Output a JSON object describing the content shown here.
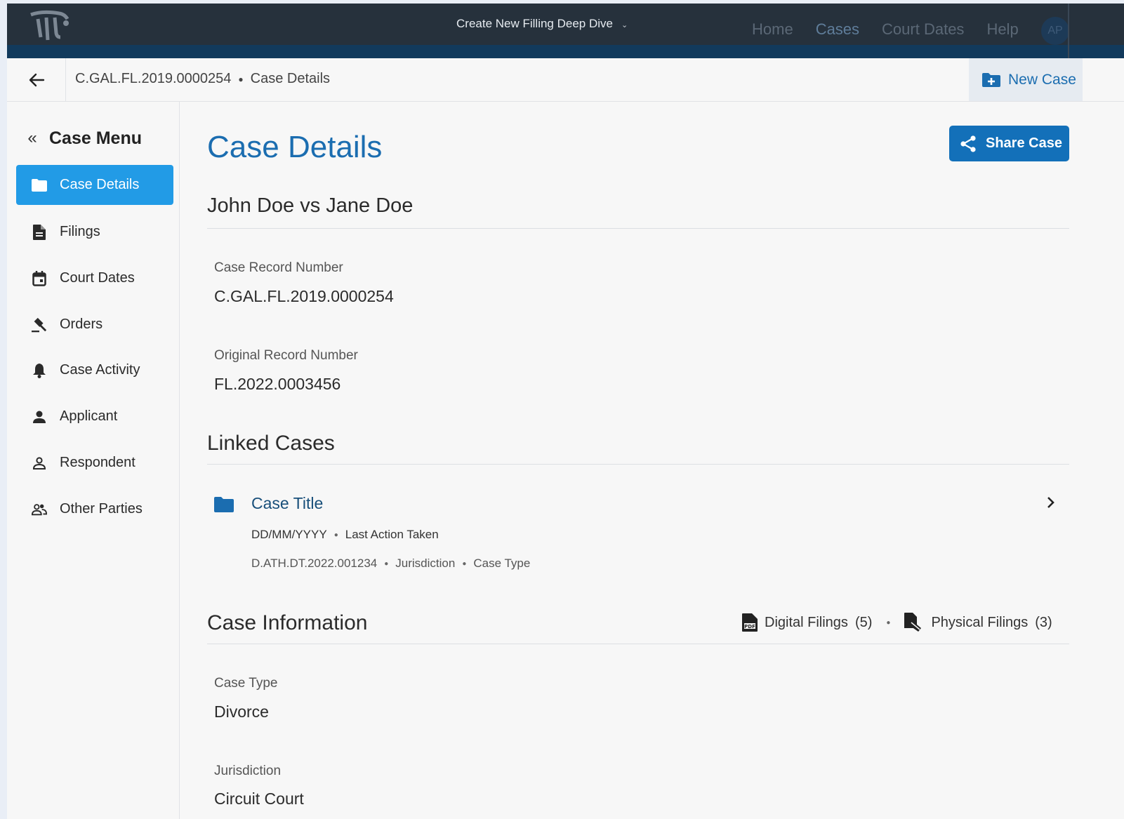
{
  "topbar": {
    "app_title": "Create New Filling Deep Dive",
    "nav": [
      "Home",
      "Cases",
      "Court Dates",
      "Help"
    ],
    "active_nav": "Cases",
    "avatar_initials": "AP"
  },
  "breadcrumb": {
    "case_number": "C.GAL.FL.2019.0000254",
    "page": "Case Details"
  },
  "new_case_label": "New Case",
  "sidebar": {
    "title": "Case Menu",
    "items": [
      {
        "label": "Case Details",
        "icon": "folder-icon",
        "active": true
      },
      {
        "label": "Filings",
        "icon": "document-icon"
      },
      {
        "label": "Court Dates",
        "icon": "calendar-icon"
      },
      {
        "label": "Orders",
        "icon": "gavel-icon"
      },
      {
        "label": "Case Activity",
        "icon": "bell-icon"
      },
      {
        "label": "Applicant",
        "icon": "person-icon"
      },
      {
        "label": "Respondent",
        "icon": "person-outline-icon"
      },
      {
        "label": "Other Parties",
        "icon": "people-icon"
      }
    ]
  },
  "main": {
    "title": "Case Details",
    "share_label": "Share Case",
    "case_name": "John Doe vs Jane Doe",
    "fields_top": [
      {
        "label": "Case Record Number",
        "value": "C.GAL.FL.2019.0000254"
      },
      {
        "label": "Original Record Number",
        "value": "FL.2022.0003456"
      }
    ],
    "linked_cases": {
      "title": "Linked Cases",
      "items": [
        {
          "title": "Case Title",
          "date": "DD/MM/YYYY",
          "last_action": "Last Action Taken",
          "record": "D.ATH.DT.2022.001234",
          "jurisdiction": "Jurisdiction",
          "case_type": "Case Type"
        }
      ]
    },
    "case_information": {
      "title": "Case Information",
      "digital_filings_label": "Digital Filings",
      "digital_filings_count": "(5)",
      "physical_filings_label": "Physical Filings",
      "physical_filings_count": "(3)",
      "fields": [
        {
          "label": "Case Type",
          "value": "Divorce"
        },
        {
          "label": "Jurisdiction",
          "value": "Circuit Court"
        }
      ]
    }
  },
  "colors": {
    "topbar": "#26313c",
    "accent_blue": "#1b6db0",
    "active_menu": "#229be6",
    "share_button": "#1370b9"
  }
}
